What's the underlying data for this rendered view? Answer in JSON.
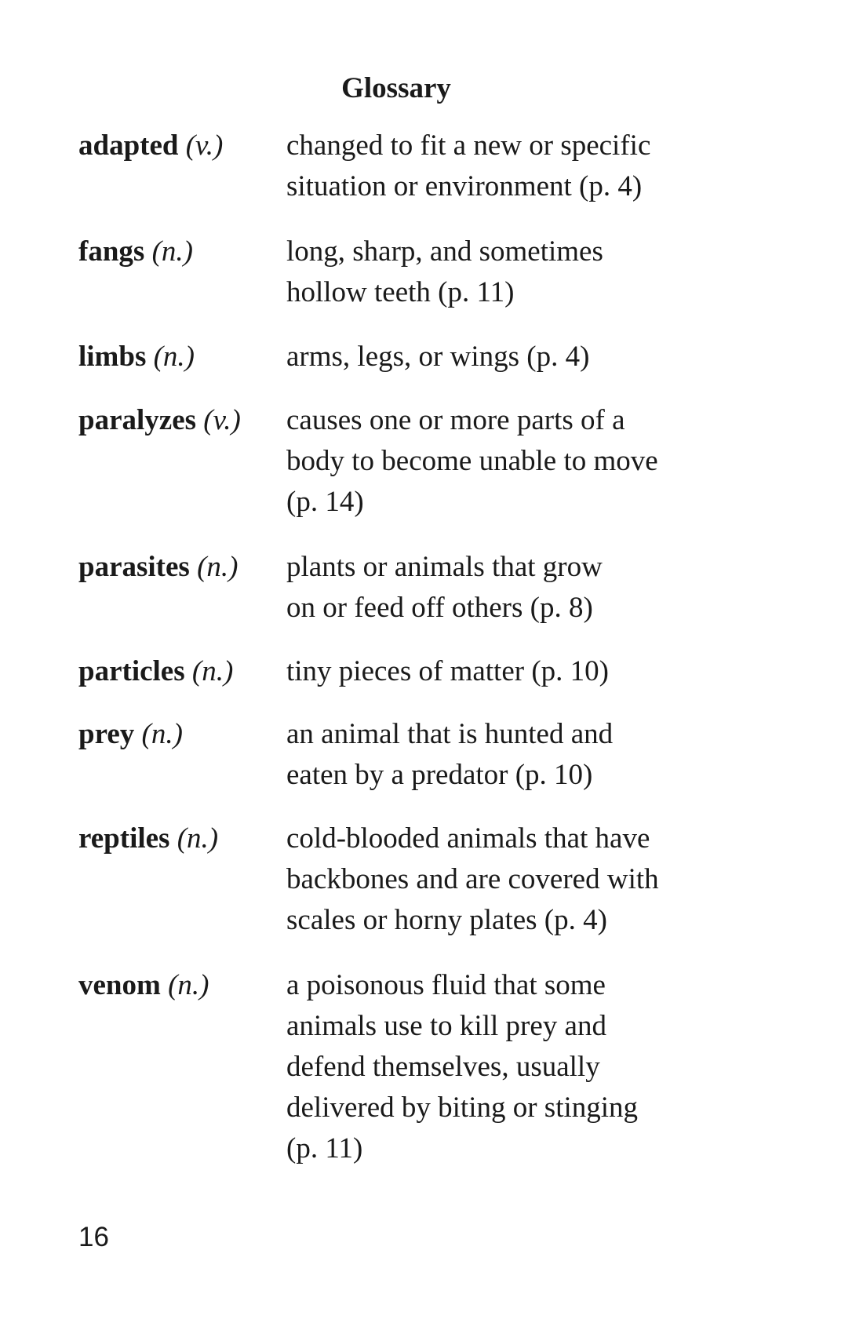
{
  "title": "Glossary",
  "entries": [
    {
      "word": "adapted",
      "pos": "(v.)",
      "lines": [
        "changed to fit a new or specific",
        "situation or environment (p. 4)"
      ]
    },
    {
      "word": "fangs",
      "pos": "(n.)",
      "lines": [
        "long, sharp, and sometimes",
        "hollow teeth (p. 11)"
      ]
    },
    {
      "word": "limbs",
      "pos": "(n.)",
      "lines": [
        "arms, legs, or wings (p. 4)"
      ]
    },
    {
      "word": "paralyzes",
      "pos": "(v.)",
      "lines": [
        "causes one or more parts of a",
        "body to become unable to move",
        "(p. 14)"
      ]
    },
    {
      "word": "parasites",
      "pos": "(n.)",
      "lines": [
        "plants or animals that grow",
        "on or feed off others (p. 8)"
      ]
    },
    {
      "word": "particles",
      "pos": "(n.)",
      "lines": [
        "tiny pieces of matter (p. 10)"
      ]
    },
    {
      "word": "prey",
      "pos": "(n.)",
      "lines": [
        "an animal that is hunted and",
        "eaten by a predator (p. 10)"
      ]
    },
    {
      "word": "reptiles",
      "pos": "(n.)",
      "lines": [
        "cold-blooded animals that have",
        "backbones and are covered with",
        "scales or horny plates (p. 4)"
      ]
    },
    {
      "word": "venom",
      "pos": "(n.)",
      "lines": [
        "a poisonous fluid that some",
        "animals use to kill prey and",
        "defend themselves, usually",
        "delivered by biting or stinging",
        "(p. 11)"
      ]
    }
  ],
  "page_number": "16"
}
